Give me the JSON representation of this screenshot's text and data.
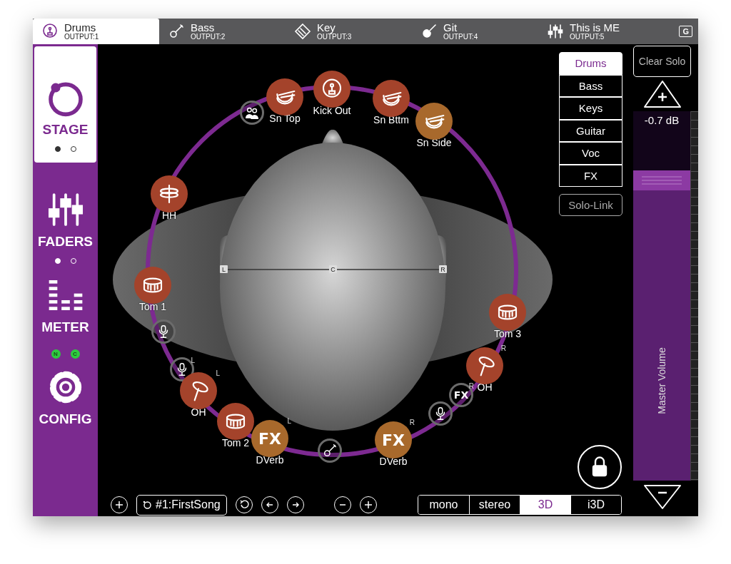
{
  "tabs": [
    {
      "label": "Drums",
      "output": "OUTPUT:1",
      "selected": true
    },
    {
      "label": "Bass",
      "output": "OUTPUT:2",
      "selected": false
    },
    {
      "label": "Key",
      "output": "OUTPUT:3",
      "selected": false
    },
    {
      "label": "Git",
      "output": "OUTPUT:4",
      "selected": false
    },
    {
      "label": "This is ME",
      "output": "OUTPUT:5",
      "selected": false
    }
  ],
  "tab_bar_badge": "G",
  "sidebar": {
    "items": [
      {
        "label": "STAGE",
        "selected": true,
        "pages": [
          {
            "selected": true
          },
          {
            "selected": false
          }
        ]
      },
      {
        "label": "FADERS",
        "selected": false,
        "pages": [
          {
            "selected": true
          },
          {
            "selected": false
          }
        ]
      },
      {
        "label": "METER",
        "selected": false
      },
      {
        "label": "CONFIG",
        "selected": false
      }
    ],
    "indicators": [
      {
        "label": "N",
        "on": true
      },
      {
        "label": "C",
        "on": true
      }
    ]
  },
  "stage": {
    "pan_markers": [
      "L",
      "C",
      "R"
    ],
    "nodes": [
      {
        "kind": "ring"
      },
      {
        "kind": "source",
        "label": "Sn Top",
        "color": "#a4432b"
      },
      {
        "kind": "source",
        "label": "Kick Out",
        "color": "#a4432b"
      },
      {
        "kind": "source",
        "label": "Sn Bttm",
        "color": "#a4432b"
      },
      {
        "kind": "source",
        "label": "Sn Side",
        "color": "#a8692c"
      },
      {
        "kind": "source",
        "label": "HH",
        "color": "#a4432b"
      },
      {
        "kind": "source",
        "label": "Tom 1",
        "color": "#a4432b"
      },
      {
        "kind": "ring"
      },
      {
        "kind": "ring",
        "side": "L"
      },
      {
        "kind": "source",
        "label": "OH",
        "color": "#a4432b",
        "side": "L"
      },
      {
        "kind": "source",
        "label": "Tom 2",
        "color": "#a4432b"
      },
      {
        "kind": "source",
        "label": "DVerb",
        "color": "#a8692c",
        "side": "L",
        "glyph": "FX"
      },
      {
        "kind": "ring"
      },
      {
        "kind": "source",
        "label": "DVerb",
        "color": "#a8692c",
        "side": "R",
        "glyph": "FX"
      },
      {
        "kind": "ring"
      },
      {
        "kind": "ring",
        "side": "R",
        "glyph": "FX"
      },
      {
        "kind": "source",
        "label": "OH",
        "color": "#a4432b",
        "side": "R"
      },
      {
        "kind": "source",
        "label": "Tom 3",
        "color": "#a4432b"
      }
    ]
  },
  "groups": [
    {
      "label": "Drums",
      "selected": true
    },
    {
      "label": "Bass",
      "selected": false
    },
    {
      "label": "Keys",
      "selected": false
    },
    {
      "label": "Guitar",
      "selected": false
    },
    {
      "label": "Voc",
      "selected": false
    },
    {
      "label": "FX",
      "selected": false
    }
  ],
  "solo_link": "Solo-Link",
  "clear_solo": "Clear Solo",
  "master": {
    "reading": "-0.7 dB",
    "label": "Master Volume",
    "level": 0.84
  },
  "bottom_bar": {
    "song": "#1:FirstSong",
    "modes": [
      {
        "label": "mono",
        "selected": false
      },
      {
        "label": "stereo",
        "selected": false
      },
      {
        "label": "3D",
        "selected": true
      },
      {
        "label": "i3D",
        "selected": false
      }
    ]
  }
}
